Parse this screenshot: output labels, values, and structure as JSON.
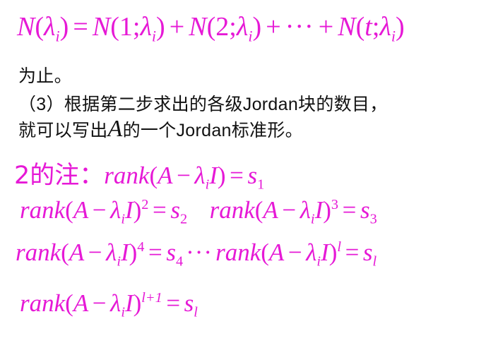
{
  "colors": {
    "math": "#e619d6",
    "text": "#111111"
  },
  "formula_top": {
    "lhs": "N(λi)",
    "terms": [
      "N(1; λi)",
      "N(2; λi)",
      "N(t; λi)"
    ]
  },
  "paragraph": {
    "line1": "为止。",
    "line2": "（3）根据第二步求出的各级Jordan块的数目，",
    "line3_a": "就可以写出",
    "line3_math": "A",
    "line3_b": "的一个Jordan标准形。"
  },
  "note": {
    "label": "2的注：",
    "rank_word": "rank",
    "equations": [
      {
        "power": "",
        "s_index": "1"
      },
      {
        "power": "2",
        "s_index": "2"
      },
      {
        "power": "3",
        "s_index": "3"
      },
      {
        "power": "4",
        "s_index": "4"
      },
      {
        "power": "l",
        "s_index": "l"
      },
      {
        "power": "l+1",
        "s_index": "l"
      }
    ]
  }
}
